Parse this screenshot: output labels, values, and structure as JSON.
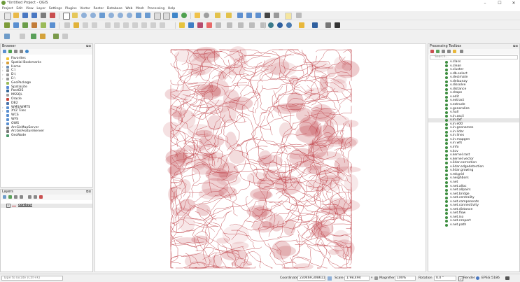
{
  "window": {
    "title": "*Untitled Project - QGIS",
    "minimize": "–",
    "maximize": "☐",
    "close": "✕"
  },
  "menu": [
    "Project",
    "Edit",
    "View",
    "Layer",
    "Settings",
    "Plugins",
    "Vector",
    "Raster",
    "Database",
    "Web",
    "Mesh",
    "Processing",
    "Help"
  ],
  "browser": {
    "title": "Browser",
    "controls": "⧉⊠",
    "items": [
      {
        "label": "Favorites",
        "color": "#f2c230",
        "arrow": ""
      },
      {
        "label": "Spatial Bookmarks",
        "color": "#d8a03a",
        "arrow": "›"
      },
      {
        "label": "Home",
        "color": "#6e8fb5",
        "arrow": "›"
      },
      {
        "label": "C:\\",
        "color": "#9a9a9a",
        "arrow": "›"
      },
      {
        "label": "D:\\",
        "color": "#9a9a9a",
        "arrow": "›"
      },
      {
        "label": "E:\\",
        "color": "#9a9a9a",
        "arrow": "›"
      },
      {
        "label": "GeoPackage",
        "color": "#9bbb59",
        "arrow": ""
      },
      {
        "label": "SpatiaLite",
        "color": "#5b8bd6",
        "arrow": ""
      },
      {
        "label": "PostGIS",
        "color": "#336699",
        "arrow": ""
      },
      {
        "label": "MSSQL",
        "color": "#a0a0a0",
        "arrow": ""
      },
      {
        "label": "Oracle",
        "color": "#c8453b",
        "arrow": ""
      },
      {
        "label": "DB2",
        "color": "#4a72a8",
        "arrow": ""
      },
      {
        "label": "WMS/WMTS",
        "color": "#5a8fd0",
        "arrow": "›"
      },
      {
        "label": "XYZ Tiles",
        "color": "#5a8fd0",
        "arrow": "›"
      },
      {
        "label": "WCS",
        "color": "#5a8fd0",
        "arrow": ""
      },
      {
        "label": "WFS",
        "color": "#5a8fd0",
        "arrow": ""
      },
      {
        "label": "OWS",
        "color": "#5a8fd0",
        "arrow": ""
      },
      {
        "label": "ArcGisMapServer",
        "color": "#7a7a7a",
        "arrow": ""
      },
      {
        "label": "ArcGisFeatureServer",
        "color": "#7a7a7a",
        "arrow": ""
      },
      {
        "label": "GeoNode",
        "color": "#4a9a6a",
        "arrow": ""
      }
    ]
  },
  "layers": {
    "title": "Layers",
    "controls": "⧉⊠",
    "items": [
      {
        "label": "contour",
        "checked": "✓"
      }
    ]
  },
  "toolbox": {
    "title": "Processing Toolbox",
    "controls": "⧉⊠",
    "search_placeholder": "Search...",
    "items": [
      "v.class",
      "v.clean",
      "v.cluster",
      "v.db.select",
      "v.decimate",
      "v.delaunay",
      "v.dissolve",
      "v.distance",
      "v.drape",
      "v.edit",
      "v.extract",
      "v.extrude",
      "v.generalize",
      "v.hull",
      "v.in.ascii",
      "v.in.dxf",
      "v.in.e00",
      "v.in.geonames",
      "v.in.lidar",
      "v.in.lines",
      "v.in.mapgen",
      "v.in.wfs",
      "v.info",
      "v.kcv",
      "v.kernel.rast",
      "v.kernel.vector",
      "v.lidar.correction",
      "v.lidar.edgedetection",
      "v.lidar.growing",
      "v.mkgrid",
      "v.neighbors",
      "v.net",
      "v.net.alloc",
      "v.net.allpairs",
      "v.net.bridge",
      "v.net.centrality",
      "v.net.components",
      "v.net.connectivity",
      "v.net.distance",
      "v.net.flow",
      "v.net.iso",
      "v.net.nreport",
      "v.net.path"
    ],
    "selected": "v.in.dxf"
  },
  "status": {
    "locate_placeholder": "Type to locate (Ctrl+K)",
    "coordinate_label": "Coordinate",
    "coordinate_value": "230469,308611",
    "scale_label": "Scale",
    "scale_value": "1:98,494",
    "magnifier_label": "Magnifier",
    "magnifier_value": "100%",
    "rotation_label": "Rotation",
    "rotation_value": "0.0 °",
    "render_label": "Render",
    "crs_label": "EPSG:5186"
  },
  "colors": {
    "contour": "#c0434a",
    "accent": "#3e8e41"
  }
}
